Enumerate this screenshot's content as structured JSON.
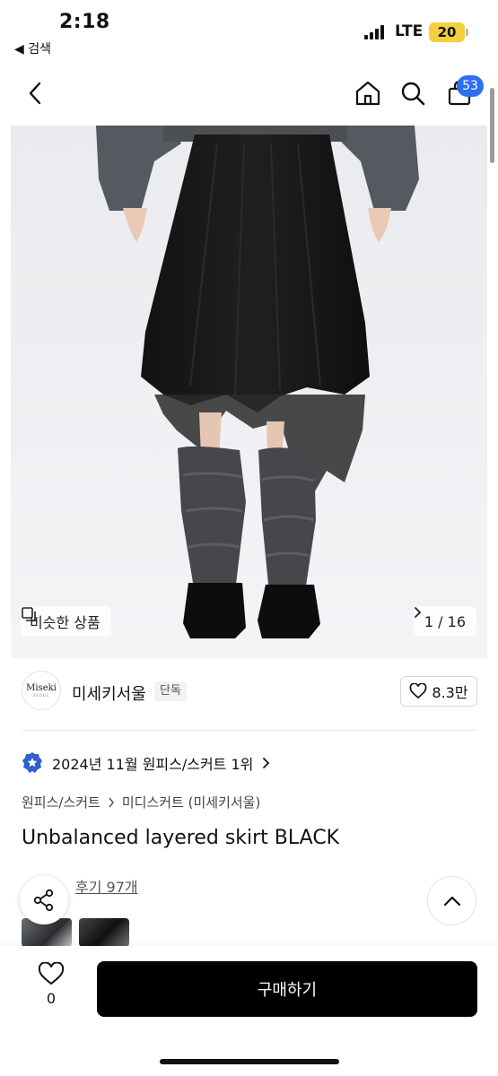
{
  "status_bar": {
    "time": "2:18",
    "back_app": "◀ 검색",
    "network": "LTE",
    "battery": "20"
  },
  "header": {
    "cart_count": "53"
  },
  "gallery": {
    "similar_label": "비슷한 상품",
    "pager": "1 / 16"
  },
  "brand": {
    "logo_line1": "Miseki",
    "logo_line2": "SEOUL",
    "name": "미세키서울",
    "tag": "단독",
    "likes": "8.3만"
  },
  "product": {
    "ranking": "2024년 11월 원피스/스커트 1위",
    "breadcrumb": [
      "원피스/스커트",
      "미디스커트 (미세키서울)"
    ],
    "title": "Unbalanced layered skirt BLACK",
    "review_label": "후기 97개"
  },
  "bottom_bar": {
    "wish_count": "0",
    "buy_label": "구매하기"
  },
  "colors": {
    "accent": "#2d6ff0",
    "ranking_badge": "#2f5fd0",
    "buy_button": "#000000"
  },
  "icons": [
    "back-arrow-icon",
    "home-icon",
    "search-icon",
    "shopping-bag-icon",
    "similar-icon",
    "chevron-right-icon",
    "heart-icon",
    "ranking-badge-icon",
    "share-icon",
    "chevron-up-icon"
  ]
}
